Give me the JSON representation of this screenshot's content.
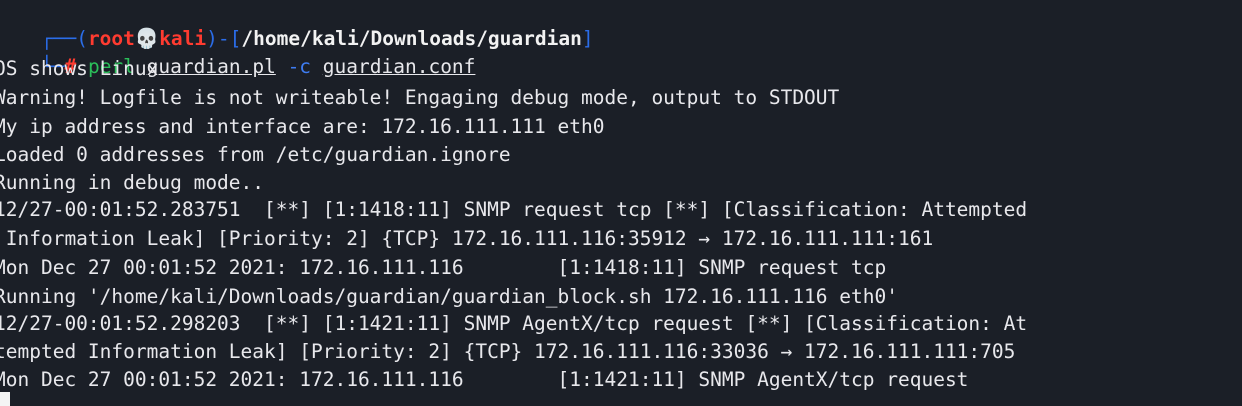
{
  "prompt": {
    "corner_top": "┌──(",
    "user": "root",
    "skull": "💀",
    "host": "kali",
    "mid": ")-[",
    "path": "/home/kali/Downloads/guardian",
    "close": "]",
    "corner_bottom": "└─",
    "hash": "#",
    "command": "perl",
    "script": "guardian.pl",
    "flag": "-c",
    "config": "guardian.conf"
  },
  "output_lines": [
    "OS shows Linux",
    "Warning! Logfile is not writeable! Engaging debug mode, output to STDOUT",
    "My ip address and interface are: 172.16.111.111 eth0",
    "Loaded 0 addresses from /etc/guardian.ignore",
    "Running in debug mode..",
    "12/27-00:01:52.283751  [**] [1:1418:11] SNMP request tcp [**] [Classification: Attempted",
    " Information Leak] [Priority: 2] {TCP} 172.16.111.116:35912 → 172.16.111.111:161",
    "Mon Dec 27 00:01:52 2021: 172.16.111.116        [1:1418:11] SNMP request tcp",
    "Running '/home/kali/Downloads/guardian/guardian_block.sh 172.16.111.116 eth0'",
    "12/27-00:01:52.298203  [**] [1:1421:11] SNMP AgentX/tcp request [**] [Classification: At",
    "tempted Information Leak] [Priority: 2] {TCP} 172.16.111.116:33036 → 172.16.111.111:705",
    "Mon Dec 27 00:01:52 2021: 172.16.111.116        [1:1421:11] SNMP AgentX/tcp request"
  ],
  "colors": {
    "background": "#1b1f27",
    "text": "#e8e8ec",
    "prompt_frame": "#2b6de9",
    "root_user": "#ff3b30",
    "command": "#2bbf5a"
  }
}
